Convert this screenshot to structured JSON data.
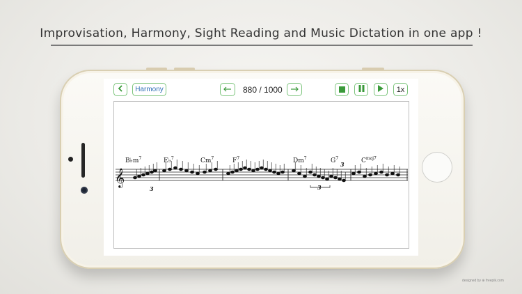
{
  "headline": "Improvisation, Harmony, Sight Reading and Music Dictation in one app !",
  "toolbar": {
    "back_icon": "chevron-left-icon",
    "mode_label": "Harmony",
    "prev_icon": "arrow-left-icon",
    "counter": "880 / 1000",
    "next_icon": "arrow-right-icon",
    "stop_icon": "stop-icon",
    "pause_icon": "pause-icon",
    "play_icon": "play-icon",
    "speed_label": "1x"
  },
  "score": {
    "clef": "treble",
    "chords": [
      {
        "root": "B♭m",
        "quality": "7"
      },
      {
        "root": "E♭",
        "quality": "7"
      },
      {
        "root": "Cm",
        "quality": "7"
      },
      {
        "root": "F",
        "quality": "7"
      },
      {
        "root": "Dm",
        "quality": "7"
      },
      {
        "root": "G",
        "quality": "7"
      },
      {
        "root": "C",
        "quality": "maj7"
      }
    ],
    "triplet_label_1": "3",
    "triplet_label_2": "3",
    "triplet_label_3": "3"
  },
  "colors": {
    "accent": "#3a9a3a",
    "link": "#2f6fb5"
  },
  "credit": "designed by ⊕ freepik.com"
}
